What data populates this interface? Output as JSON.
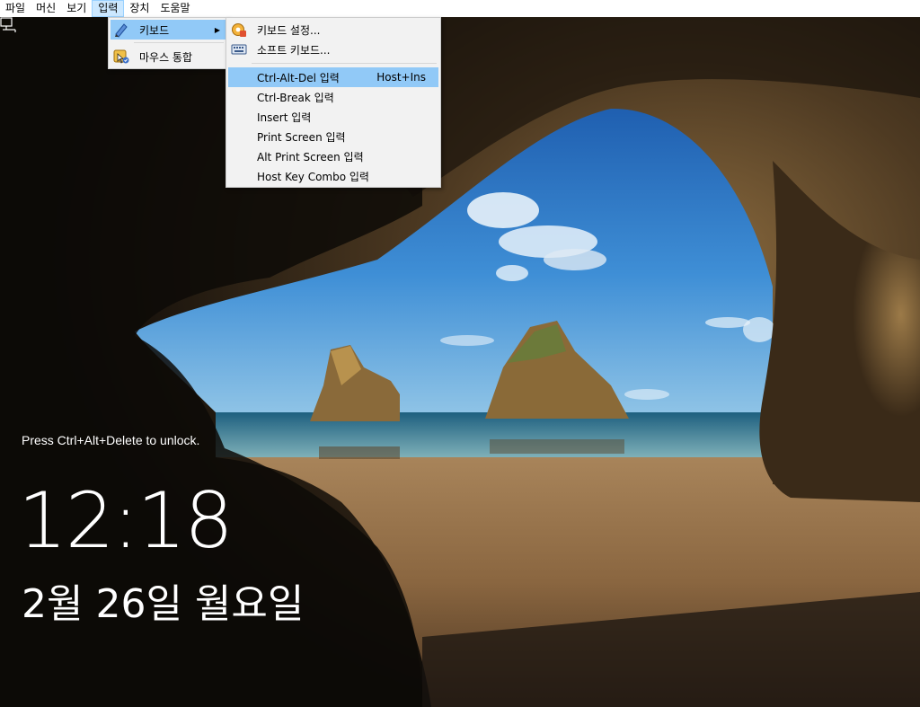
{
  "menubar": {
    "items": [
      "파일",
      "머신",
      "보기",
      "입력",
      "장치",
      "도움말"
    ]
  },
  "input_menu": {
    "keyboard": "키보드",
    "mouse_integration": "마우스 통합"
  },
  "keyboard_menu": {
    "settings": "키보드 설정...",
    "soft_keyboard": "소프트 키보드...",
    "items": [
      {
        "label": "Ctrl-Alt-Del 입력",
        "shortcut": "Host+Ins"
      },
      {
        "label": "Ctrl-Break 입력",
        "shortcut": ""
      },
      {
        "label": "Insert 입력",
        "shortcut": ""
      },
      {
        "label": "Print Screen 입력",
        "shortcut": ""
      },
      {
        "label": "Alt Print Screen 입력",
        "shortcut": ""
      },
      {
        "label": "Host Key Combo 입력",
        "shortcut": ""
      }
    ]
  },
  "lockscreen": {
    "hint": "Press Ctrl+Alt+Delete to unlock.",
    "time": "12:18",
    "date": "2월 26일 월요일"
  },
  "icons": {
    "keyboard": "keyboard-pen-icon",
    "mouse": "mouse-integration-icon",
    "settings": "keyboard-settings-icon",
    "soft_keyboard": "soft-keyboard-icon",
    "network": "network-icon"
  },
  "colors": {
    "menu_bg": "#f2f2f2",
    "highlight": "#91c9f7",
    "menubar_active": "#cce8ff"
  }
}
